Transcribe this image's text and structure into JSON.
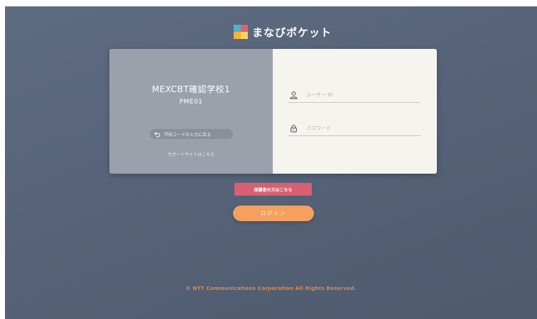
{
  "brand": {
    "logo_text": "まなびポケット",
    "colors": {
      "blue": "#4fb3c9",
      "red": "#e85d75",
      "orange": "#f3b23d",
      "yellow": "#f7d35a"
    }
  },
  "school": {
    "name": "MEXCBT確認学校1",
    "code": "PME01",
    "back_label": "学校コードの入力に戻る",
    "support_link": "サポートサイトはこちら"
  },
  "form": {
    "user_id_placeholder": "ユーザー ID",
    "password_placeholder": "パスワード"
  },
  "buttons": {
    "guardian_label": "保護者の方はこちら",
    "login_label": "ログイン"
  },
  "footer": {
    "copyright": "© NTT Communications Corporation All Rights Reserved."
  },
  "icons": {
    "user": "user-icon",
    "lock": "lock-icon",
    "back": "back-arrow-icon"
  },
  "colors": {
    "guardian_button": "#d95f72",
    "login_button": "#f5a05f",
    "footer_text": "#e58a45",
    "school_panel": "#9aa1ab",
    "form_panel": "#f6f4ef"
  }
}
